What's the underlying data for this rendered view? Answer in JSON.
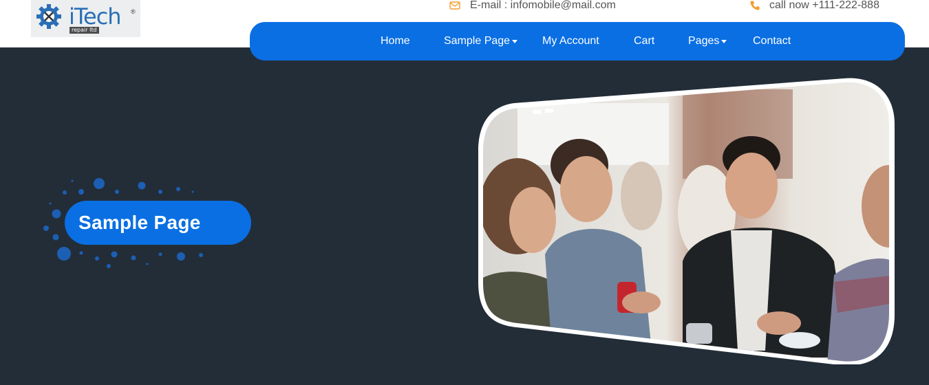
{
  "brand": {
    "logo_name": "iTech",
    "logo_tagline": "repair ltd",
    "logo_registered": "®",
    "logo_icon": "gear-icon"
  },
  "contact": {
    "email_icon": "envelope-icon",
    "email_text": "E-mail : infomobile@mail.com",
    "phone_icon": "phone-icon",
    "phone_text": "call now +111-222-888"
  },
  "nav": {
    "items": [
      {
        "label": "Home",
        "has_dropdown": false
      },
      {
        "label": "Sample Page",
        "has_dropdown": true
      },
      {
        "label": "My Account",
        "has_dropdown": false
      },
      {
        "label": "Cart",
        "has_dropdown": false
      },
      {
        "label": "Pages",
        "has_dropdown": true
      },
      {
        "label": "Contact",
        "has_dropdown": false
      }
    ]
  },
  "hero": {
    "title": "Sample Page",
    "image_alt": "photo of people talking at a social event"
  },
  "colors": {
    "accent": "#0a6fe3",
    "background": "#232d38",
    "icon_orange": "#f39c2b"
  }
}
